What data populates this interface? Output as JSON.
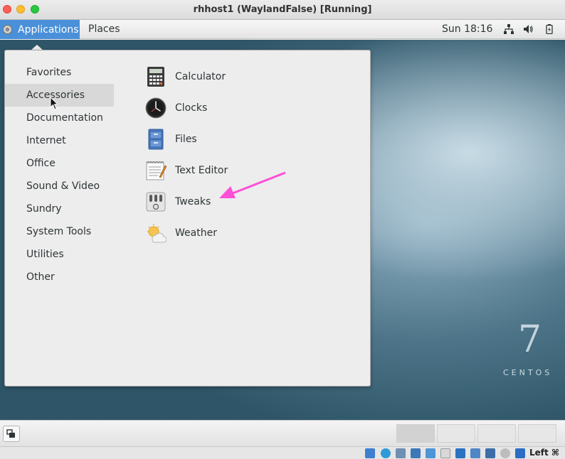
{
  "window": {
    "title": "rhhost1 (WaylandFalse) [Running]"
  },
  "topbar": {
    "applications_label": "Applications",
    "places_label": "Places",
    "clock": "Sun 18:16"
  },
  "menu": {
    "categories": [
      "Favorites",
      "Accessories",
      "Documentation",
      "Internet",
      "Office",
      "Sound & Video",
      "Sundry",
      "System Tools",
      "Utilities",
      "Other"
    ],
    "hovered_category": "Accessories",
    "apps": [
      {
        "label": "Calculator",
        "icon": "calculator-icon"
      },
      {
        "label": "Clocks",
        "icon": "clock-icon"
      },
      {
        "label": "Files",
        "icon": "file-cabinet-icon"
      },
      {
        "label": "Text Editor",
        "icon": "text-editor-icon"
      },
      {
        "label": "Tweaks",
        "icon": "tweaks-icon"
      },
      {
        "label": "Weather",
        "icon": "weather-icon"
      }
    ]
  },
  "desktop": {
    "logo_number": "7",
    "logo_word": "CENTOS"
  },
  "statusbar": {
    "host_key": "Left ⌘"
  },
  "colors": {
    "accent": "#4a90d9",
    "annotation_arrow": "#ff4fd8"
  }
}
